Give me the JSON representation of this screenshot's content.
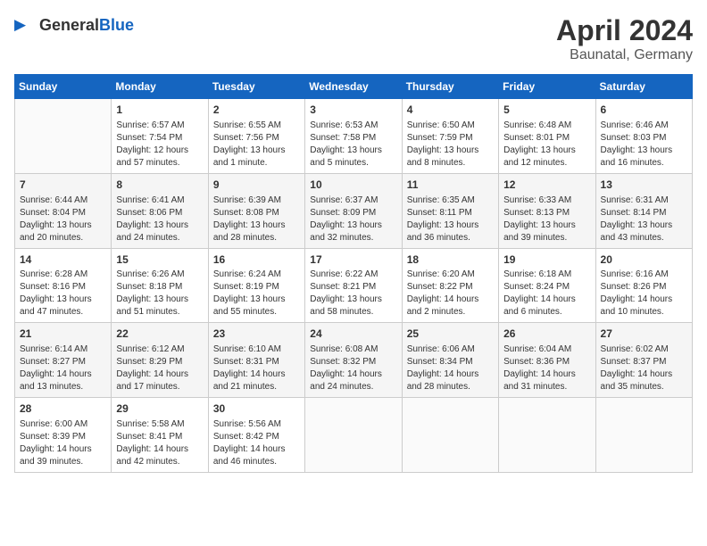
{
  "header": {
    "logo_general": "General",
    "logo_blue": "Blue",
    "month_year": "April 2024",
    "location": "Baunatal, Germany"
  },
  "weekdays": [
    "Sunday",
    "Monday",
    "Tuesday",
    "Wednesday",
    "Thursday",
    "Friday",
    "Saturday"
  ],
  "days": [
    {
      "num": "",
      "info": ""
    },
    {
      "num": "1",
      "info": "Sunrise: 6:57 AM\nSunset: 7:54 PM\nDaylight: 12 hours\nand 57 minutes."
    },
    {
      "num": "2",
      "info": "Sunrise: 6:55 AM\nSunset: 7:56 PM\nDaylight: 13 hours\nand 1 minute."
    },
    {
      "num": "3",
      "info": "Sunrise: 6:53 AM\nSunset: 7:58 PM\nDaylight: 13 hours\nand 5 minutes."
    },
    {
      "num": "4",
      "info": "Sunrise: 6:50 AM\nSunset: 7:59 PM\nDaylight: 13 hours\nand 8 minutes."
    },
    {
      "num": "5",
      "info": "Sunrise: 6:48 AM\nSunset: 8:01 PM\nDaylight: 13 hours\nand 12 minutes."
    },
    {
      "num": "6",
      "info": "Sunrise: 6:46 AM\nSunset: 8:03 PM\nDaylight: 13 hours\nand 16 minutes."
    },
    {
      "num": "7",
      "info": "Sunrise: 6:44 AM\nSunset: 8:04 PM\nDaylight: 13 hours\nand 20 minutes."
    },
    {
      "num": "8",
      "info": "Sunrise: 6:41 AM\nSunset: 8:06 PM\nDaylight: 13 hours\nand 24 minutes."
    },
    {
      "num": "9",
      "info": "Sunrise: 6:39 AM\nSunset: 8:08 PM\nDaylight: 13 hours\nand 28 minutes."
    },
    {
      "num": "10",
      "info": "Sunrise: 6:37 AM\nSunset: 8:09 PM\nDaylight: 13 hours\nand 32 minutes."
    },
    {
      "num": "11",
      "info": "Sunrise: 6:35 AM\nSunset: 8:11 PM\nDaylight: 13 hours\nand 36 minutes."
    },
    {
      "num": "12",
      "info": "Sunrise: 6:33 AM\nSunset: 8:13 PM\nDaylight: 13 hours\nand 39 minutes."
    },
    {
      "num": "13",
      "info": "Sunrise: 6:31 AM\nSunset: 8:14 PM\nDaylight: 13 hours\nand 43 minutes."
    },
    {
      "num": "14",
      "info": "Sunrise: 6:28 AM\nSunset: 8:16 PM\nDaylight: 13 hours\nand 47 minutes."
    },
    {
      "num": "15",
      "info": "Sunrise: 6:26 AM\nSunset: 8:18 PM\nDaylight: 13 hours\nand 51 minutes."
    },
    {
      "num": "16",
      "info": "Sunrise: 6:24 AM\nSunset: 8:19 PM\nDaylight: 13 hours\nand 55 minutes."
    },
    {
      "num": "17",
      "info": "Sunrise: 6:22 AM\nSunset: 8:21 PM\nDaylight: 13 hours\nand 58 minutes."
    },
    {
      "num": "18",
      "info": "Sunrise: 6:20 AM\nSunset: 8:22 PM\nDaylight: 14 hours\nand 2 minutes."
    },
    {
      "num": "19",
      "info": "Sunrise: 6:18 AM\nSunset: 8:24 PM\nDaylight: 14 hours\nand 6 minutes."
    },
    {
      "num": "20",
      "info": "Sunrise: 6:16 AM\nSunset: 8:26 PM\nDaylight: 14 hours\nand 10 minutes."
    },
    {
      "num": "21",
      "info": "Sunrise: 6:14 AM\nSunset: 8:27 PM\nDaylight: 14 hours\nand 13 minutes."
    },
    {
      "num": "22",
      "info": "Sunrise: 6:12 AM\nSunset: 8:29 PM\nDaylight: 14 hours\nand 17 minutes."
    },
    {
      "num": "23",
      "info": "Sunrise: 6:10 AM\nSunset: 8:31 PM\nDaylight: 14 hours\nand 21 minutes."
    },
    {
      "num": "24",
      "info": "Sunrise: 6:08 AM\nSunset: 8:32 PM\nDaylight: 14 hours\nand 24 minutes."
    },
    {
      "num": "25",
      "info": "Sunrise: 6:06 AM\nSunset: 8:34 PM\nDaylight: 14 hours\nand 28 minutes."
    },
    {
      "num": "26",
      "info": "Sunrise: 6:04 AM\nSunset: 8:36 PM\nDaylight: 14 hours\nand 31 minutes."
    },
    {
      "num": "27",
      "info": "Sunrise: 6:02 AM\nSunset: 8:37 PM\nDaylight: 14 hours\nand 35 minutes."
    },
    {
      "num": "28",
      "info": "Sunrise: 6:00 AM\nSunset: 8:39 PM\nDaylight: 14 hours\nand 39 minutes."
    },
    {
      "num": "29",
      "info": "Sunrise: 5:58 AM\nSunset: 8:41 PM\nDaylight: 14 hours\nand 42 minutes."
    },
    {
      "num": "30",
      "info": "Sunrise: 5:56 AM\nSunset: 8:42 PM\nDaylight: 14 hours\nand 46 minutes."
    },
    {
      "num": "",
      "info": ""
    },
    {
      "num": "",
      "info": ""
    },
    {
      "num": "",
      "info": ""
    },
    {
      "num": "",
      "info": ""
    }
  ]
}
